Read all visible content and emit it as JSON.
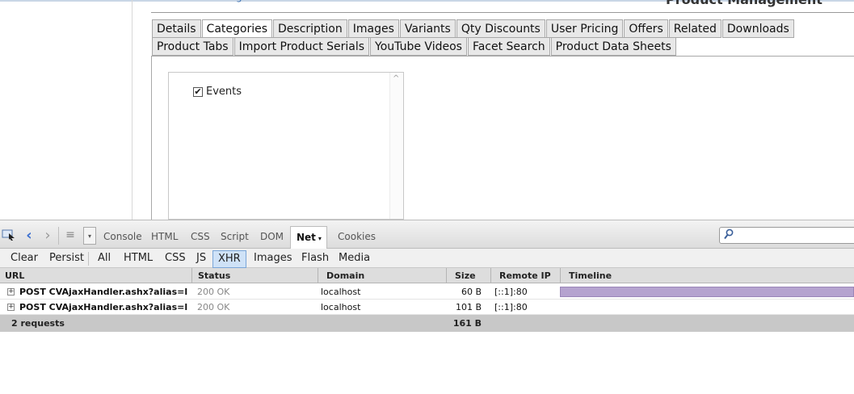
{
  "page": {
    "header_title": "Product Management",
    "header_link": "g"
  },
  "tabs": {
    "row1": [
      "Details",
      "Categories",
      "Description",
      "Images",
      "Variants",
      "Qty Discounts",
      "User Pricing",
      "Offers",
      "Related",
      "Downloads"
    ],
    "row2": [
      "Product Tabs",
      "Import Product Serials",
      "YouTube Videos",
      "Facet Search",
      "Product Data Sheets"
    ],
    "active": "Categories"
  },
  "categories": {
    "items": [
      {
        "label": "Events",
        "checked": true,
        "check_glyph": "✔"
      }
    ],
    "scroll_up_glyph": "^"
  },
  "devtools": {
    "toolbar": {
      "icons": [
        "inspect-icon",
        "back-icon",
        "forward-icon",
        "menu-icon",
        "dropdown-icon"
      ],
      "back_glyph": "‹",
      "forward_glyph": "›",
      "menu_glyph": "≡",
      "dropdown_glyph": "▾",
      "tabs": [
        "Console",
        "HTML",
        "CSS",
        "Script",
        "DOM",
        "Net",
        "Cookies"
      ],
      "active_tab": "Net",
      "net_caret": "▾",
      "search_placeholder": "",
      "search_glyph": "⚲"
    },
    "subbar": {
      "actions": [
        "Clear",
        "Persist"
      ],
      "filters": [
        "All",
        "HTML",
        "CSS",
        "JS",
        "XHR",
        "Images",
        "Flash",
        "Media"
      ],
      "active_filter": "XHR"
    },
    "net": {
      "columns": [
        "URL",
        "Status",
        "Domain",
        "Size",
        "Remote IP",
        "Timeline"
      ],
      "rows": [
        {
          "url": "POST CVAjaxHandler.ashx?alias=loc",
          "status": "200 OK",
          "domain": "localhost",
          "size": "60 B",
          "remote_ip": "[::1]:80",
          "has_timeline": true
        },
        {
          "url": "POST CVAjaxHandler.ashx?alias=loc",
          "status": "200 OK",
          "domain": "localhost",
          "size": "101 B",
          "remote_ip": "[::1]:80",
          "has_timeline": false
        }
      ],
      "expander_glyph": "+",
      "summary": {
        "requests": "2 requests",
        "total_size": "161 B"
      }
    }
  }
}
